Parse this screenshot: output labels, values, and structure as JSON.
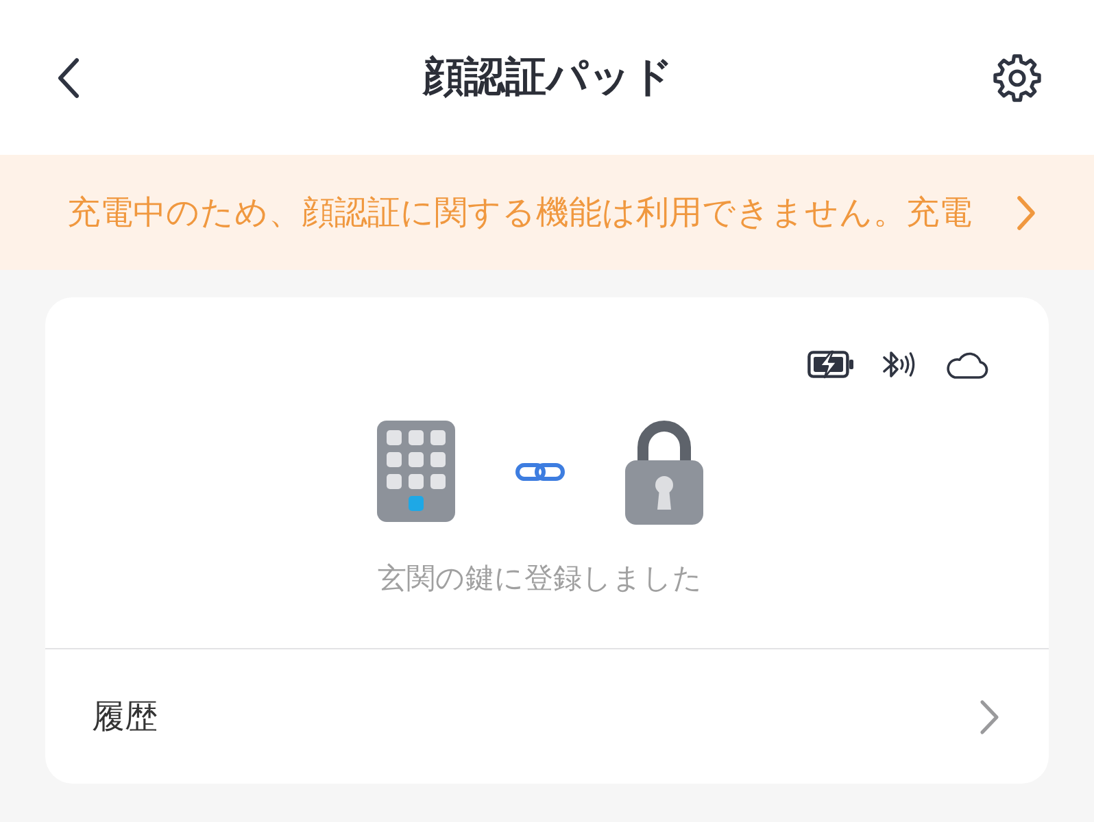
{
  "header": {
    "title": "顔認証パッド"
  },
  "notice": {
    "text": "充電中のため、顔認証に関する機能は利用できません。充電"
  },
  "device_card": {
    "caption": "玄関の鍵に登録しました"
  },
  "menu": [
    {
      "label": "履歴"
    }
  ]
}
